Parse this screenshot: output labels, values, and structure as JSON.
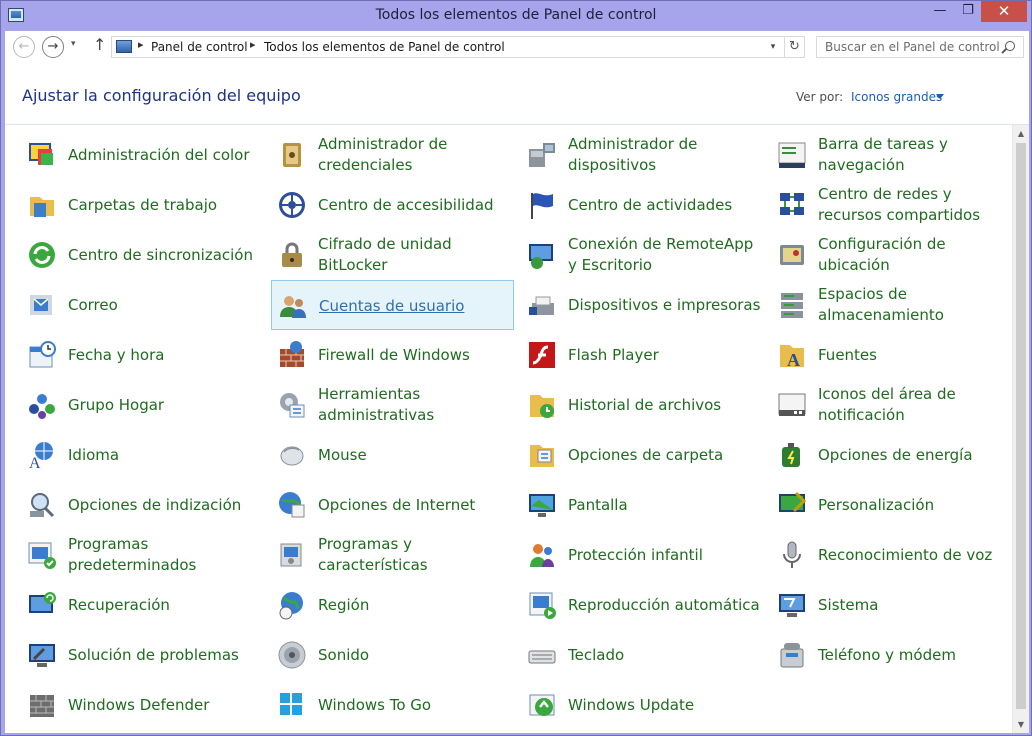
{
  "window": {
    "title": "Todos los elementos de Panel de control",
    "minimize_glyph": "—",
    "maximize_glyph": "❐",
    "close_glyph": "✕"
  },
  "address_bar": {
    "back_glyph": "←",
    "forward_glyph": "→",
    "up_glyph": "↑",
    "crumbs": [
      "Panel de control",
      "Todos los elementos de Panel de control"
    ],
    "separator": "▸",
    "refresh_glyph": "↻",
    "dropdown_glyph": "▾"
  },
  "search": {
    "placeholder": "Buscar en el Panel de control"
  },
  "header": {
    "title": "Ajustar la configuración del equipo",
    "view_label": "Ver por:",
    "view_value": "Iconos grandes"
  },
  "colors": {
    "link_green": "#1f6b1f",
    "title_blue": "#1e3287",
    "selection": "#e5f3fb"
  },
  "items": [
    {
      "label": "Administración del color",
      "icon": "color-management-icon"
    },
    {
      "label": "Administrador de credenciales",
      "icon": "credential-manager-icon"
    },
    {
      "label": "Administrador de dispositivos",
      "icon": "device-manager-icon"
    },
    {
      "label": "Barra de tareas y navegación",
      "icon": "taskbar-icon"
    },
    {
      "label": "Carpetas de trabajo",
      "icon": "work-folders-icon"
    },
    {
      "label": "Centro de accesibilidad",
      "icon": "ease-of-access-icon"
    },
    {
      "label": "Centro de actividades",
      "icon": "action-center-flag-icon"
    },
    {
      "label": "Centro de redes y recursos compartidos",
      "icon": "network-center-icon"
    },
    {
      "label": "Centro de sincronización",
      "icon": "sync-center-icon"
    },
    {
      "label": "Cifrado de unidad BitLocker",
      "icon": "bitlocker-icon"
    },
    {
      "label": "Conexión de RemoteApp y Escritorio",
      "icon": "remoteapp-icon"
    },
    {
      "label": "Configuración de ubicación",
      "icon": "location-settings-icon"
    },
    {
      "label": "Correo",
      "icon": "mail-icon"
    },
    {
      "label": "Cuentas de usuario",
      "icon": "user-accounts-icon",
      "selected": true
    },
    {
      "label": "Dispositivos e impresoras",
      "icon": "devices-printers-icon"
    },
    {
      "label": "Espacios de almacenamiento",
      "icon": "storage-spaces-icon"
    },
    {
      "label": "Fecha y hora",
      "icon": "date-time-icon"
    },
    {
      "label": "Firewall de Windows",
      "icon": "firewall-icon"
    },
    {
      "label": "Flash Player",
      "icon": "flash-player-icon"
    },
    {
      "label": "Fuentes",
      "icon": "fonts-icon"
    },
    {
      "label": "Grupo Hogar",
      "icon": "homegroup-icon"
    },
    {
      "label": "Herramientas administrativas",
      "icon": "admin-tools-icon"
    },
    {
      "label": "Historial de archivos",
      "icon": "file-history-icon"
    },
    {
      "label": "Iconos del área de notificación",
      "icon": "notification-area-icon"
    },
    {
      "label": "Idioma",
      "icon": "language-icon"
    },
    {
      "label": "Mouse",
      "icon": "mouse-icon"
    },
    {
      "label": "Opciones de carpeta",
      "icon": "folder-options-icon"
    },
    {
      "label": "Opciones de energía",
      "icon": "power-options-icon"
    },
    {
      "label": "Opciones de indización",
      "icon": "indexing-options-icon"
    },
    {
      "label": "Opciones de Internet",
      "icon": "internet-options-icon"
    },
    {
      "label": "Pantalla",
      "icon": "display-icon"
    },
    {
      "label": "Personalización",
      "icon": "personalization-icon"
    },
    {
      "label": "Programas predeterminados",
      "icon": "default-programs-icon"
    },
    {
      "label": "Programas y características",
      "icon": "programs-features-icon"
    },
    {
      "label": "Protección infantil",
      "icon": "family-safety-icon"
    },
    {
      "label": "Reconocimiento de voz",
      "icon": "microphone-icon"
    },
    {
      "label": "Recuperación",
      "icon": "recovery-icon"
    },
    {
      "label": "Región",
      "icon": "region-globe-icon"
    },
    {
      "label": "Reproducción automática",
      "icon": "autoplay-icon"
    },
    {
      "label": "Sistema",
      "icon": "system-icon"
    },
    {
      "label": "Solución de problemas",
      "icon": "troubleshooting-icon"
    },
    {
      "label": "Sonido",
      "icon": "sound-icon"
    },
    {
      "label": "Teclado",
      "icon": "keyboard-icon"
    },
    {
      "label": "Teléfono y módem",
      "icon": "phone-modem-icon"
    },
    {
      "label": "Windows Defender",
      "icon": "windows-defender-icon"
    },
    {
      "label": "Windows To Go",
      "icon": "windows-to-go-icon"
    },
    {
      "label": "Windows Update",
      "icon": "windows-update-icon"
    }
  ],
  "scrollbar": {
    "up_glyph": "▲",
    "down_glyph": "▼"
  }
}
